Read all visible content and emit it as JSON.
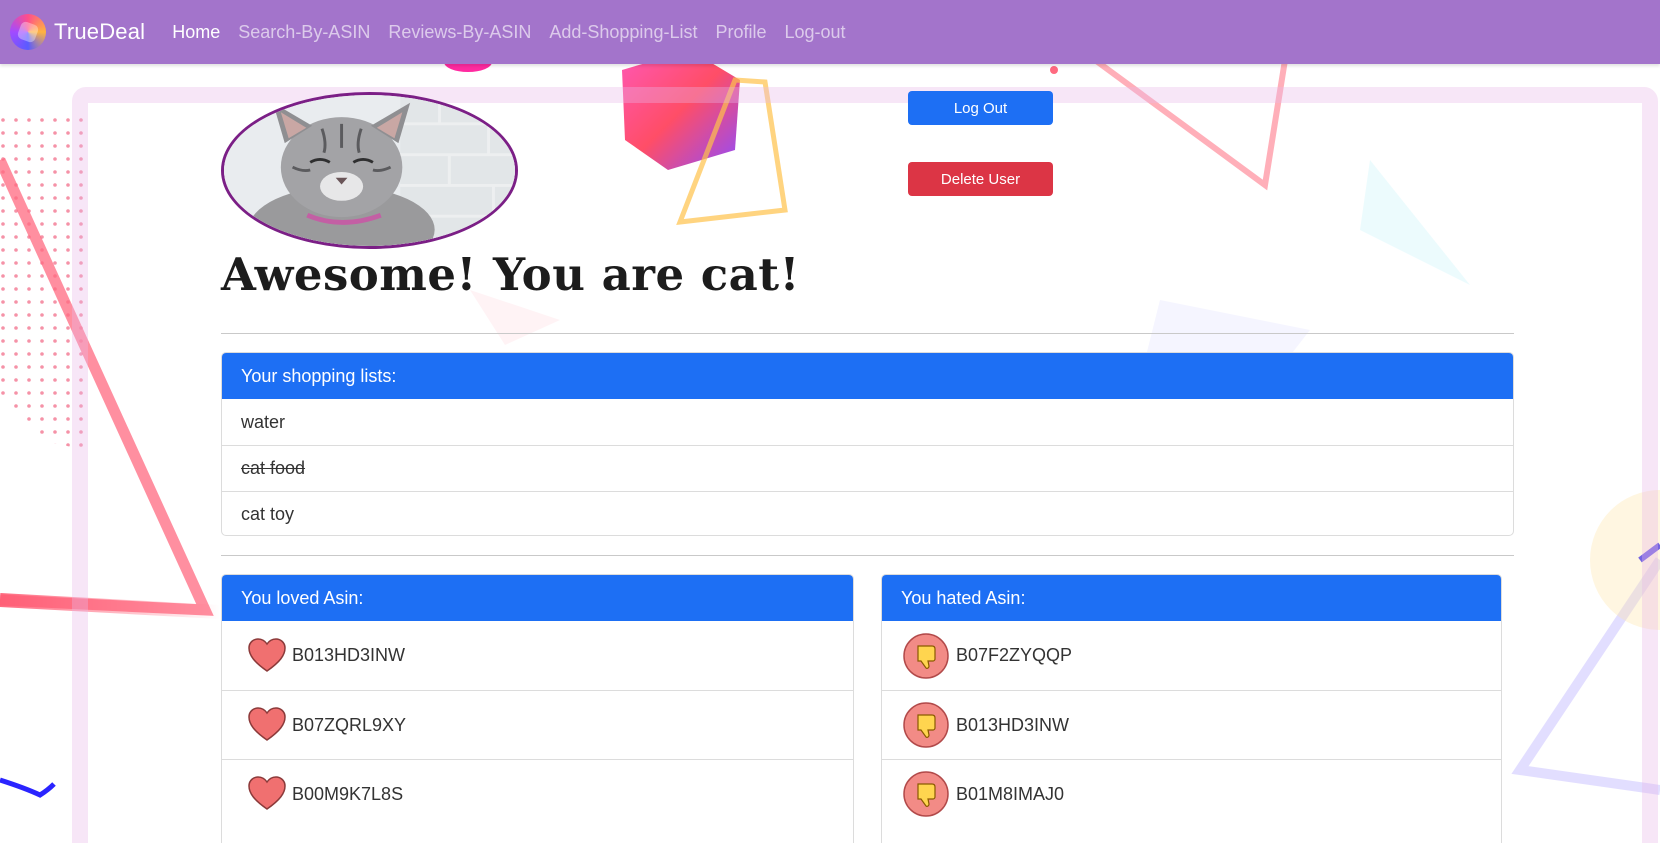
{
  "navbar": {
    "brand": "TrueDeal",
    "links": [
      {
        "label": "Home",
        "active": true
      },
      {
        "label": "Search-By-ASIN",
        "active": false
      },
      {
        "label": "Reviews-By-ASIN",
        "active": false
      },
      {
        "label": "Add-Shopping-List",
        "active": false
      },
      {
        "label": "Profile",
        "active": false
      },
      {
        "label": "Log-out",
        "active": false
      }
    ]
  },
  "profile": {
    "title": "Awesome! You are cat!",
    "logout_label": "Log Out",
    "delete_label": "Delete User"
  },
  "shopping_lists": {
    "header": "Your shopping lists:",
    "items": [
      {
        "label": "water",
        "done": false
      },
      {
        "label": "cat food",
        "done": true
      },
      {
        "label": "cat toy",
        "done": false
      }
    ]
  },
  "loved": {
    "header": "You loved Asin:",
    "icon": "heart-icon",
    "items": [
      "B013HD3INW",
      "B07ZQRL9XY",
      "B00M9K7L8S"
    ]
  },
  "hated": {
    "header": "You hated Asin:",
    "icon": "thumbs-down-icon",
    "items": [
      "B07F2ZYQQP",
      "B013HD3INW",
      "B01M8IMAJ0"
    ]
  },
  "colors": {
    "navbar": "#a374cb",
    "primary": "#1d6ff4",
    "danger": "#dc3545",
    "avatar_border": "#7b1f86",
    "heart": "#f07070",
    "thumb_bg": "#f28b86",
    "thumb": "#ffd54f"
  }
}
